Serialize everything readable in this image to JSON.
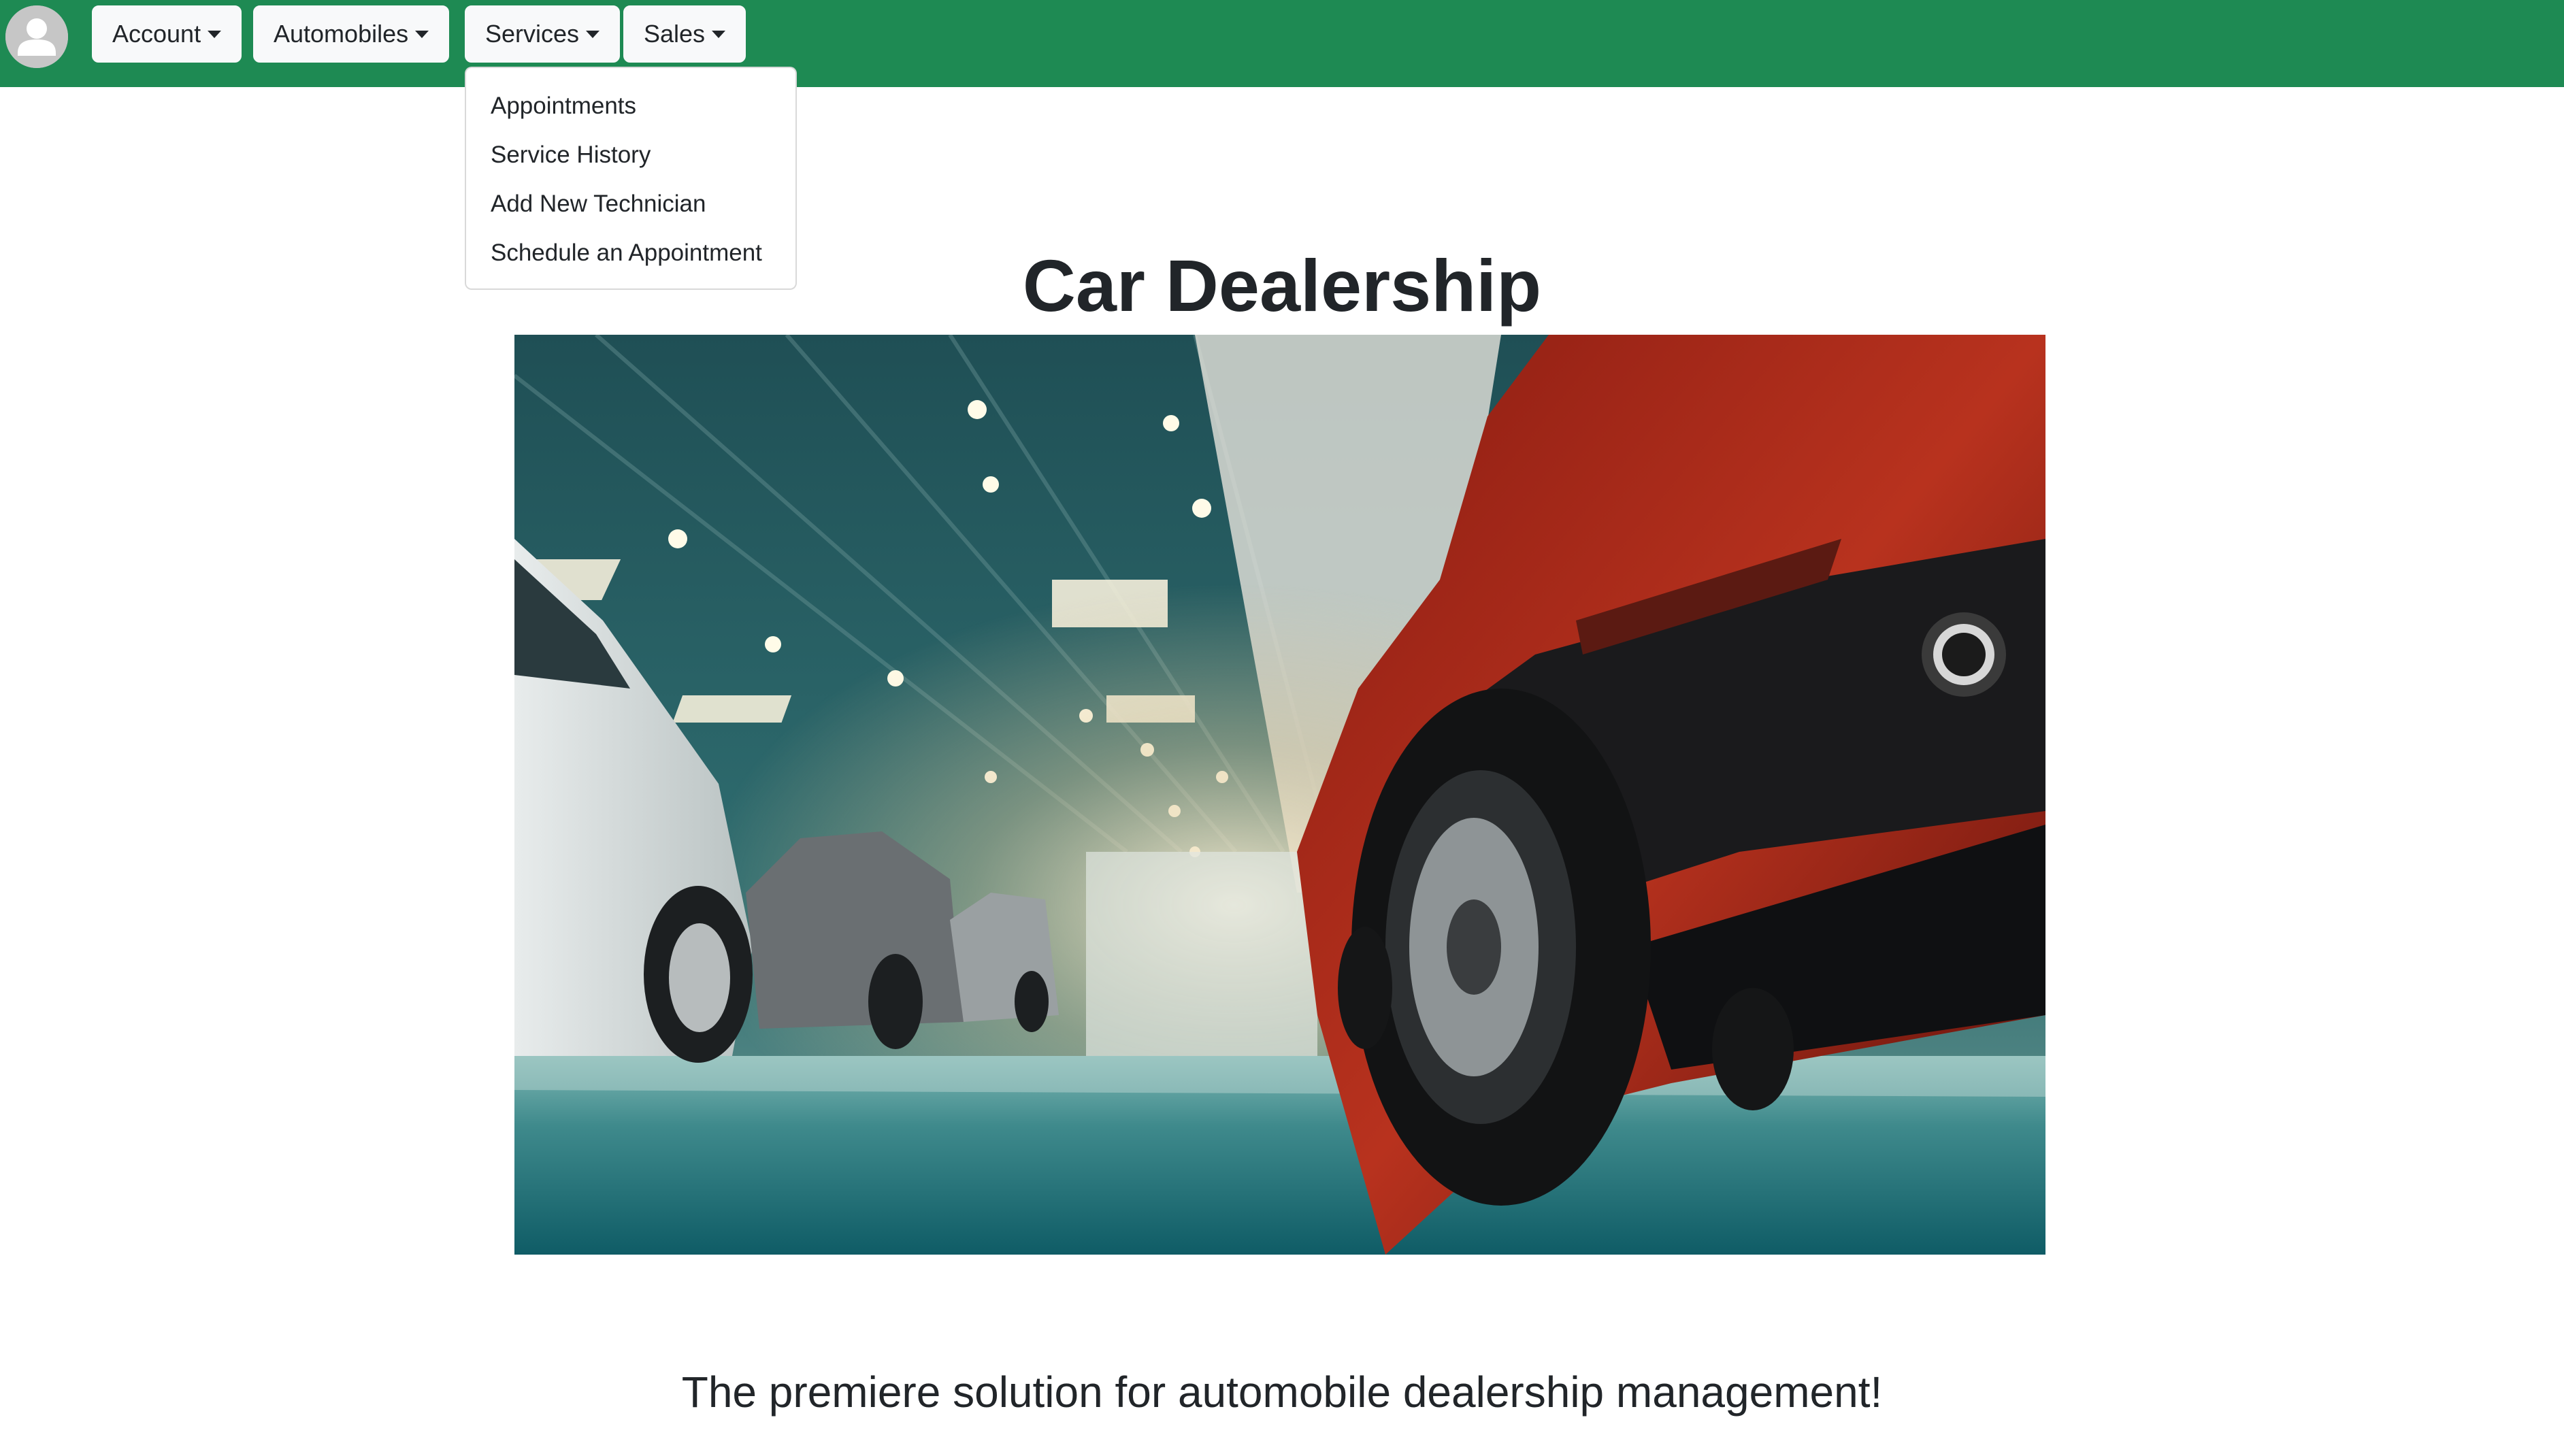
{
  "navbar": {
    "avatar_icon": "user-avatar-icon",
    "background_color": "#1e8a53",
    "menus": [
      {
        "label": "Account"
      },
      {
        "label": "Automobiles"
      },
      {
        "label": "Services"
      },
      {
        "label": "Sales"
      }
    ]
  },
  "services_dropdown": {
    "expanded": true,
    "items": [
      {
        "label": "Appointments"
      },
      {
        "label": "Service History"
      },
      {
        "label": "Add New Technician"
      },
      {
        "label": "Schedule an Appointment"
      }
    ]
  },
  "main": {
    "title": "Car Dealership",
    "tagline": "The premiere solution for automobile dealership management!"
  }
}
